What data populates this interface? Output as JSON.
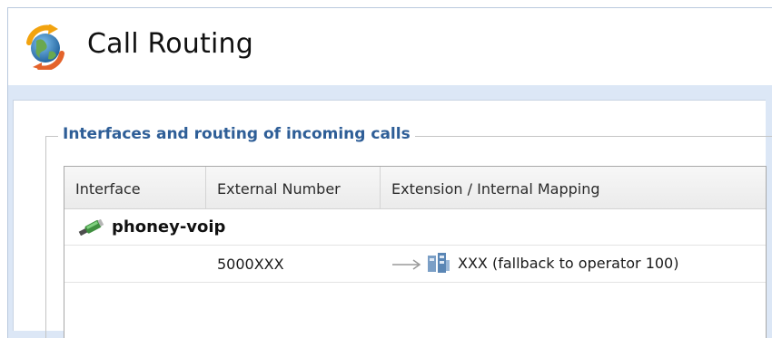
{
  "header": {
    "title": "Call Routing",
    "icon": "globe-sync-icon"
  },
  "section": {
    "legend": "Interfaces and routing of incoming calls"
  },
  "table": {
    "columns": [
      "Interface",
      "External Number",
      "Extension / Internal Mapping"
    ],
    "groups": [
      {
        "label": "phoney-voip",
        "icon": "network-plug-icon",
        "rows": [
          {
            "interface": "",
            "external_number": "5000XXX",
            "mapping": "XXX (fallback to operator 100)",
            "mapping_icon": "extension-phone-icon"
          }
        ]
      }
    ]
  },
  "colors": {
    "legend": "#2e5e97",
    "band": "#dce7f6",
    "border": "#b9c9de"
  }
}
